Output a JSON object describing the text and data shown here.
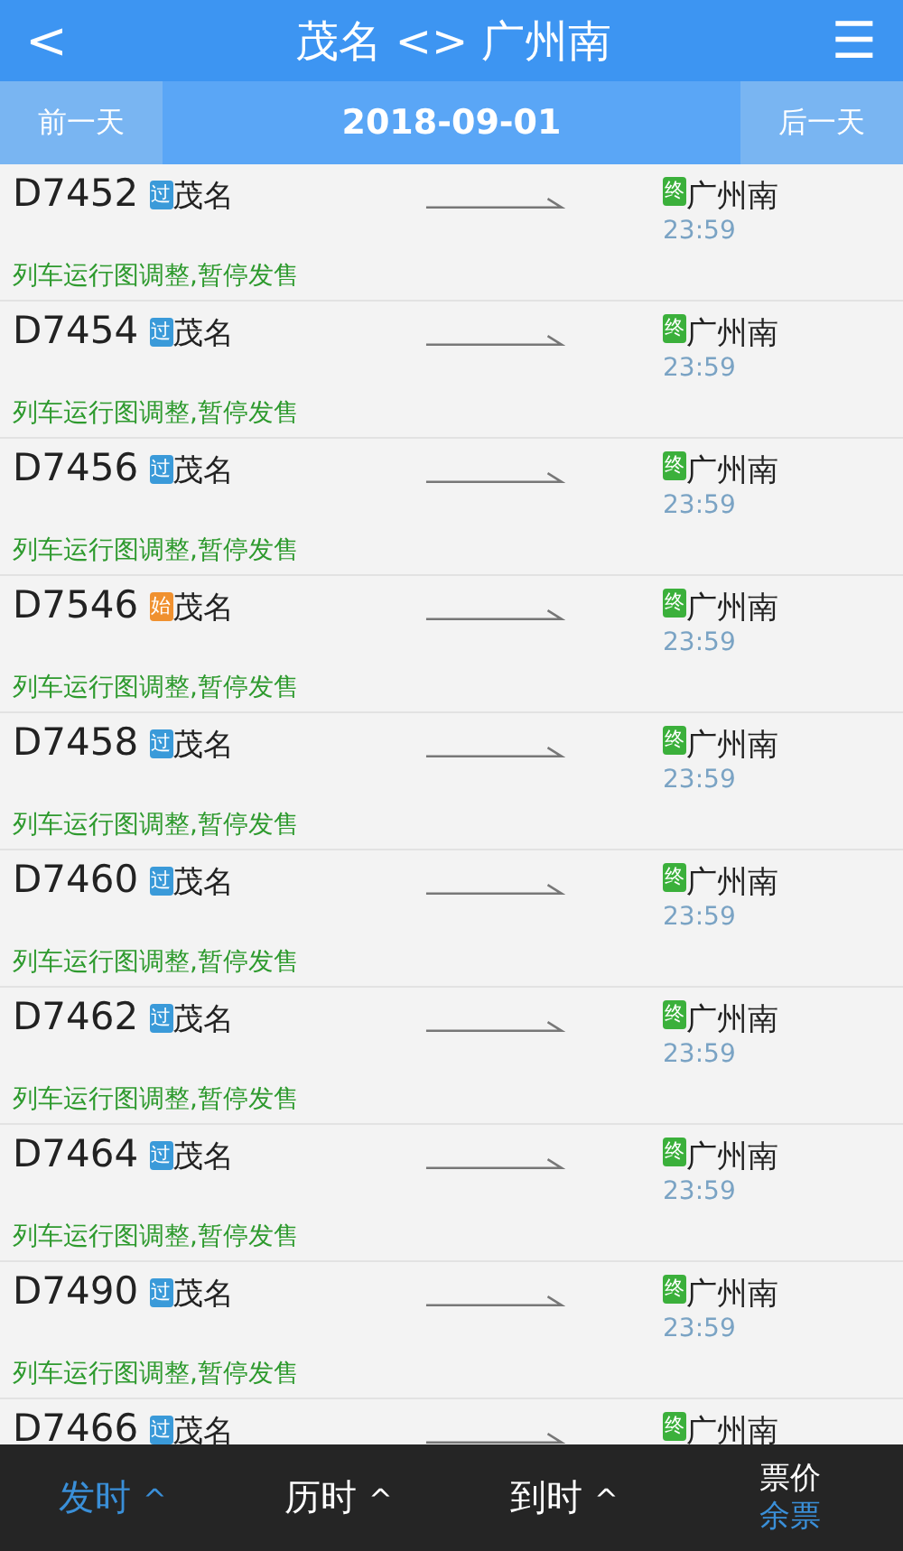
{
  "header": {
    "back": "<",
    "title": "茂名 <> 广州南",
    "menu": "☰"
  },
  "date_bar": {
    "prev": "前一天",
    "date": "2018-09-01",
    "next": "后一天"
  },
  "trains": [
    {
      "number": "D7452",
      "from_badge": "过",
      "kind": "pass",
      "from": "茂名",
      "to_badge": "终",
      "to": "广州南",
      "arrive": "23:59",
      "note": "列车运行图调整,暂停发售"
    },
    {
      "number": "D7454",
      "from_badge": "过",
      "kind": "pass",
      "from": "茂名",
      "to_badge": "终",
      "to": "广州南",
      "arrive": "23:59",
      "note": "列车运行图调整,暂停发售"
    },
    {
      "number": "D7456",
      "from_badge": "过",
      "kind": "pass",
      "from": "茂名",
      "to_badge": "终",
      "to": "广州南",
      "arrive": "23:59",
      "note": "列车运行图调整,暂停发售"
    },
    {
      "number": "D7546",
      "from_badge": "始",
      "kind": "origin",
      "from": "茂名",
      "to_badge": "终",
      "to": "广州南",
      "arrive": "23:59",
      "note": "列车运行图调整,暂停发售"
    },
    {
      "number": "D7458",
      "from_badge": "过",
      "kind": "pass",
      "from": "茂名",
      "to_badge": "终",
      "to": "广州南",
      "arrive": "23:59",
      "note": "列车运行图调整,暂停发售"
    },
    {
      "number": "D7460",
      "from_badge": "过",
      "kind": "pass",
      "from": "茂名",
      "to_badge": "终",
      "to": "广州南",
      "arrive": "23:59",
      "note": "列车运行图调整,暂停发售"
    },
    {
      "number": "D7462",
      "from_badge": "过",
      "kind": "pass",
      "from": "茂名",
      "to_badge": "终",
      "to": "广州南",
      "arrive": "23:59",
      "note": "列车运行图调整,暂停发售"
    },
    {
      "number": "D7464",
      "from_badge": "过",
      "kind": "pass",
      "from": "茂名",
      "to_badge": "终",
      "to": "广州南",
      "arrive": "23:59",
      "note": "列车运行图调整,暂停发售"
    },
    {
      "number": "D7490",
      "from_badge": "过",
      "kind": "pass",
      "from": "茂名",
      "to_badge": "终",
      "to": "广州南",
      "arrive": "23:59",
      "note": "列车运行图调整,暂停发售"
    },
    {
      "number": "D7466",
      "from_badge": "过",
      "kind": "pass",
      "from": "茂名",
      "to_badge": "终",
      "to": "广州南"
    }
  ],
  "sort_bar": [
    {
      "label": "发时",
      "caret": "^",
      "selected": true
    },
    {
      "label": "历时",
      "caret": "^",
      "selected": false
    },
    {
      "label": "到时",
      "caret": "^",
      "selected": false
    },
    {
      "label": "票价",
      "sublabel": "余票",
      "selected": false
    }
  ]
}
